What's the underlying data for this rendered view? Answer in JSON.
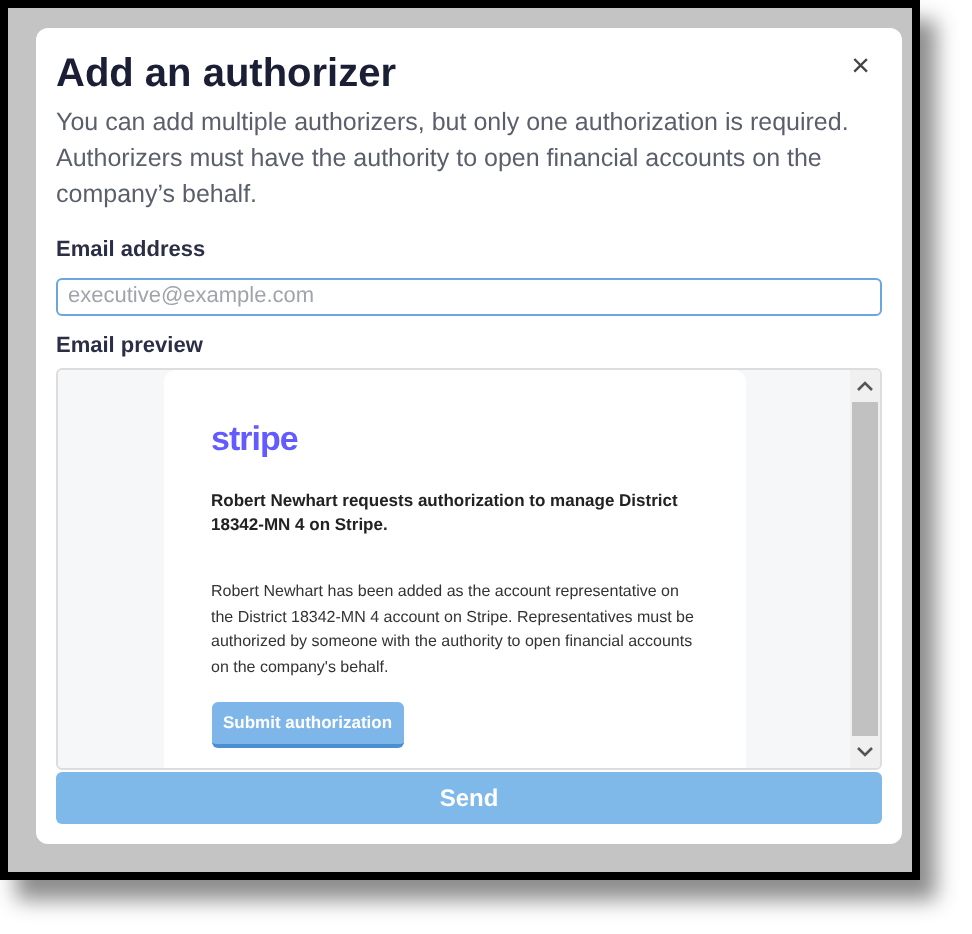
{
  "dialog": {
    "title": "Add an authorizer",
    "close_label": "×",
    "description": "You can add multiple authorizers, but only one authorization is required. Authorizers must have the authority to open financial accounts on the company’s behalf."
  },
  "email_field": {
    "label": "Email address",
    "placeholder": "executive@example.com"
  },
  "preview": {
    "label": "Email preview",
    "brand": "stripe",
    "heading": "Robert Newhart requests authorization to manage District 18342-MN 4 on Stripe.",
    "body": "Robert Newhart has been added as the account representative on the District 18342-MN 4 account on Stripe. Representatives must be authorized by someone with the authority to open financial accounts on the company's behalf.",
    "button": "Submit authorization"
  },
  "send_button": {
    "label": "Send",
    "disabled": true
  }
}
